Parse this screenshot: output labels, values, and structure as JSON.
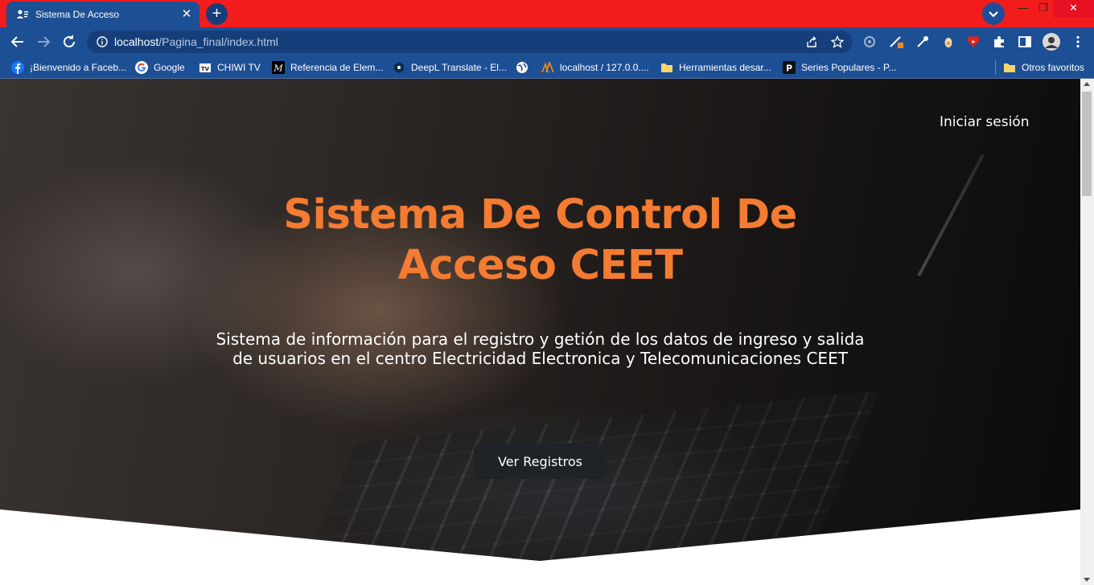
{
  "browser": {
    "tab": {
      "title": "Sistema De Acceso",
      "icon": "user-list-icon"
    },
    "address": {
      "host": "localhost",
      "path": "/Pagina_final/index.html",
      "info_icon": "info-icon"
    },
    "bookmarks": [
      {
        "label": "¡Bienvenido a Faceb...",
        "icon": "facebook-icon"
      },
      {
        "label": "Google",
        "icon": "google-icon"
      },
      {
        "label": "CHIWI TV",
        "icon": "tv-icon"
      },
      {
        "label": "Referencia de Elem...",
        "icon": "mdn-icon"
      },
      {
        "label": "DeepL Translate - El...",
        "icon": "deepl-icon"
      },
      {
        "label": "",
        "icon": "globe-icon"
      },
      {
        "label": "localhost / 127.0.0....",
        "icon": "phpmyadmin-icon"
      },
      {
        "label": "Herramientas desar...",
        "icon": "folder-icon"
      },
      {
        "label": "Series Populares - P...",
        "icon": "p-icon"
      }
    ],
    "other_bookmarks": "Otros favoritos",
    "colors": {
      "tabbar": "#f31c1c",
      "toolbar": "#1d4f95"
    }
  },
  "page": {
    "login_link": "Iniciar sesión",
    "title": "Sistema De Control De Acceso CEET",
    "description": "Sistema de información para el registro y getión de los datos de ingreso y salida de usuarios en el centro Electricidad Electronica y Telecomunicaciones CEET",
    "cta_button": "Ver Registros",
    "colors": {
      "title": "#f47b32",
      "button": "#1f2226"
    }
  }
}
